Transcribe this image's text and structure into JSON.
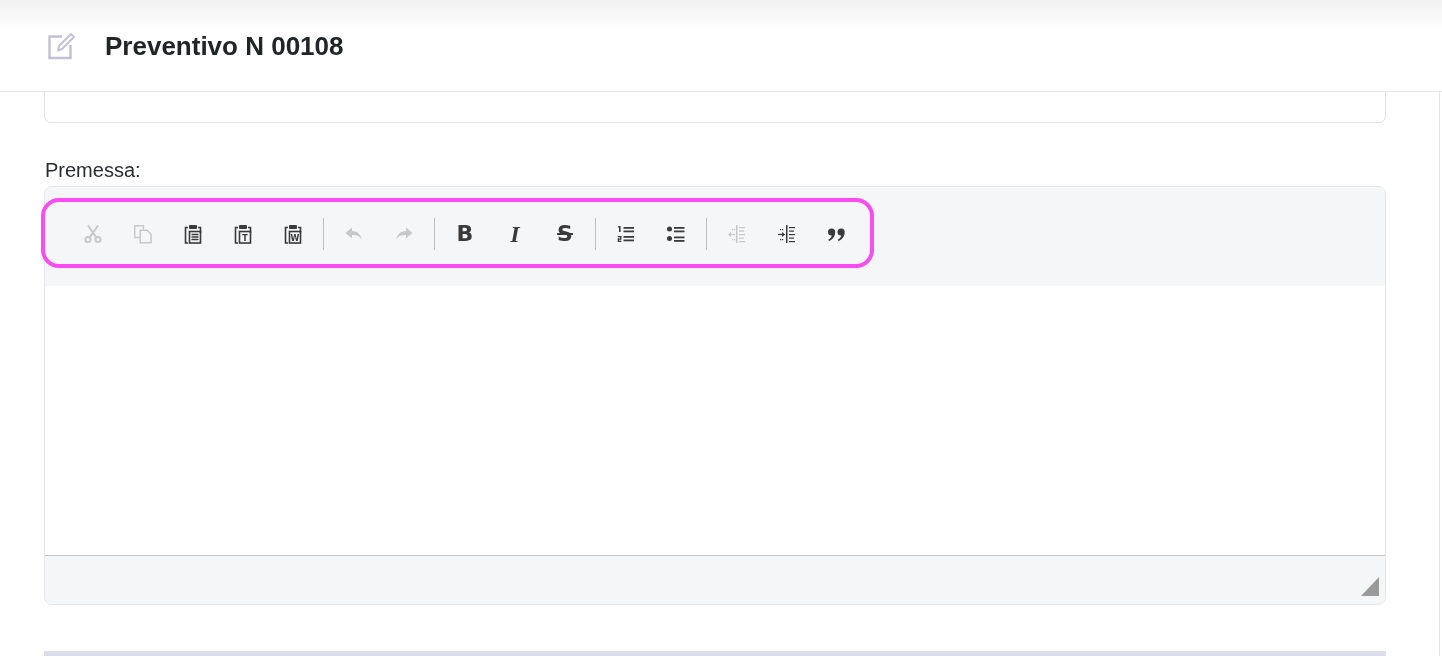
{
  "header": {
    "title": "Preventivo N 00108"
  },
  "editor": {
    "label": "Premessa:",
    "toolbar": {
      "highlighted": true,
      "groups": [
        {
          "buttons": [
            {
              "kind": "cut",
              "disabled": true
            },
            {
              "kind": "copy",
              "disabled": true
            },
            {
              "kind": "paste",
              "disabled": false
            },
            {
              "kind": "pastetext",
              "glyph": "T",
              "disabled": false
            },
            {
              "kind": "pasteword",
              "glyph": "W",
              "disabled": false
            }
          ]
        },
        {
          "buttons": [
            {
              "kind": "undo",
              "disabled": true
            },
            {
              "kind": "redo",
              "disabled": true
            }
          ]
        },
        {
          "buttons": [
            {
              "kind": "bold",
              "glyph": "B",
              "disabled": false
            },
            {
              "kind": "italic",
              "glyph": "I",
              "disabled": false
            },
            {
              "kind": "strike",
              "glyph": "S",
              "disabled": false
            }
          ]
        },
        {
          "buttons": [
            {
              "kind": "numbered",
              "disabled": false
            },
            {
              "kind": "bulleted",
              "disabled": false
            }
          ]
        },
        {
          "buttons": [
            {
              "kind": "outdent",
              "disabled": true
            },
            {
              "kind": "indent",
              "disabled": false
            },
            {
              "kind": "blockquote",
              "disabled": false
            }
          ]
        }
      ]
    }
  }
}
